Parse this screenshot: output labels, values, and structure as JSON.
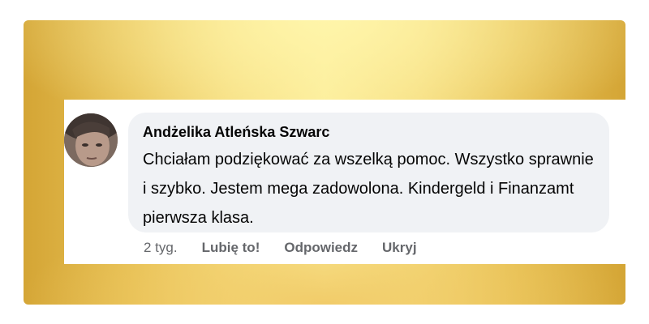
{
  "comment": {
    "author": "Andżelika Atleńska Szwarc",
    "text": "Chciałam podziękować za wszelką pomoc. Wszystko sprawnie i szybko. Jestem mega zadowolona. Kindergeld i Finanzamt pierwsza klasa.",
    "time": "2 tyg.",
    "actions": {
      "like": "Lubię to!",
      "reply": "Odpowiedz",
      "hide": "Ukryj"
    }
  },
  "colors": {
    "bubble": "#f0f2f5",
    "meta_text": "#65676b",
    "frame_gold": "#e7c155"
  }
}
